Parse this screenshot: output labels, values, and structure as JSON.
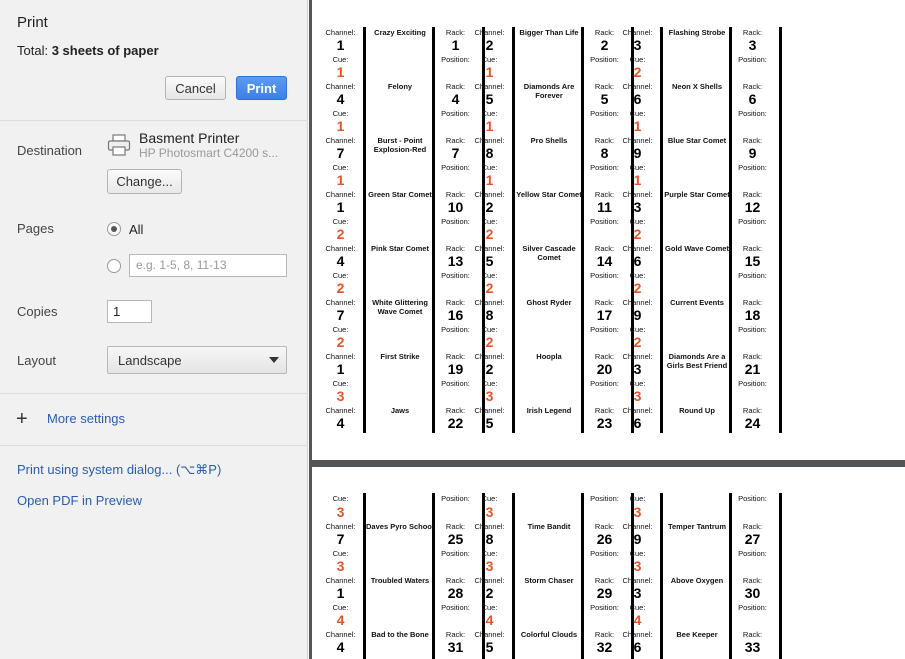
{
  "panel": {
    "title": "Print",
    "total_label": "Total:",
    "total_value": "3 sheets of paper",
    "cancel": "Cancel",
    "print": "Print",
    "destination_label": "Destination",
    "printer_name": "Basment Printer",
    "printer_model": "HP Photosmart C4200 s...",
    "change": "Change...",
    "pages_label": "Pages",
    "pages_all": "All",
    "pages_placeholder": "e.g. 1-5, 8, 11-13",
    "copies_label": "Copies",
    "copies_value": "1",
    "layout_label": "Layout",
    "layout_value": "Landscape",
    "more_settings": "More settings",
    "system_dialog": "Print using system dialog... (⌥⌘P)",
    "open_pdf": "Open PDF in Preview"
  },
  "labels": {
    "channel": "Channel:",
    "cue": "Cue:",
    "rack": "Rack:",
    "position": "Position:"
  },
  "sheet1": {
    "columns": [
      {
        "rows": [
          {
            "channel": "1",
            "cue": "1",
            "name": "Crazy Exciting",
            "rack": "1"
          },
          {
            "channel": "4",
            "cue": "1",
            "name": "Felony",
            "rack": "4"
          },
          {
            "channel": "7",
            "cue": "1",
            "name": "Burst - Point Explosion-Red",
            "rack": "7"
          },
          {
            "channel": "1",
            "cue": "2",
            "name": "Green Star Comet",
            "rack": "10"
          },
          {
            "channel": "4",
            "cue": "2",
            "name": "Pink Star Comet",
            "rack": "13"
          },
          {
            "channel": "7",
            "cue": "2",
            "name": "White Glittering Wave Comet",
            "rack": "16"
          },
          {
            "channel": "1",
            "cue": "3",
            "name": "First Strike",
            "rack": "19"
          },
          {
            "channel": "4",
            "cue": "",
            "name": "Jaws",
            "rack": "22"
          }
        ]
      },
      {
        "rows": [
          {
            "channel": "2",
            "cue": "1",
            "name": "Bigger Than Life",
            "rack": "2"
          },
          {
            "channel": "5",
            "cue": "1",
            "name": "Diamonds Are Forever",
            "rack": "5"
          },
          {
            "channel": "8",
            "cue": "1",
            "name": "Pro Shells",
            "rack": "8"
          },
          {
            "channel": "2",
            "cue": "2",
            "name": "Yellow Star Comet",
            "rack": "11"
          },
          {
            "channel": "5",
            "cue": "2",
            "name": "Silver Cascade Comet",
            "rack": "14"
          },
          {
            "channel": "8",
            "cue": "2",
            "name": "Ghost Ryder",
            "rack": "17"
          },
          {
            "channel": "2",
            "cue": "3",
            "name": "Hoopla",
            "rack": "20"
          },
          {
            "channel": "5",
            "cue": "",
            "name": "Irish Legend",
            "rack": "23"
          }
        ]
      },
      {
        "rows": [
          {
            "channel": "3",
            "cue": "2",
            "name": "Flashing Strobe",
            "rack": "3"
          },
          {
            "channel": "6",
            "cue": "1",
            "name": "Neon X Shells",
            "rack": "6"
          },
          {
            "channel": "9",
            "cue": "1",
            "name": "Blue Star Comet",
            "rack": "9"
          },
          {
            "channel": "3",
            "cue": "2",
            "name": "Purple Star Comet",
            "rack": "12"
          },
          {
            "channel": "6",
            "cue": "2",
            "name": "Gold Wave Comet",
            "rack": "15"
          },
          {
            "channel": "9",
            "cue": "2",
            "name": "Current Events",
            "rack": "18"
          },
          {
            "channel": "3",
            "cue": "3",
            "name": "Diamonds Are a Girls Best Friend",
            "rack": "21"
          },
          {
            "channel": "6",
            "cue": "",
            "name": "Round Up",
            "rack": "24"
          }
        ]
      }
    ]
  },
  "sheet2": {
    "columns": [
      {
        "top_cue": "3",
        "rows": [
          {
            "channel": "7",
            "cue": "3",
            "name": "Daves Pyro School",
            "rack": "25"
          },
          {
            "channel": "1",
            "cue": "4",
            "name": "Troubled Waters",
            "rack": "28"
          },
          {
            "channel": "4",
            "cue": "",
            "name": "Bad to the Bone",
            "rack": "31"
          }
        ]
      },
      {
        "top_cue": "3",
        "rows": [
          {
            "channel": "8",
            "cue": "3",
            "name": "Time Bandit",
            "rack": "26"
          },
          {
            "channel": "2",
            "cue": "4",
            "name": "Storm Chaser",
            "rack": "29"
          },
          {
            "channel": "5",
            "cue": "",
            "name": "Colorful Clouds",
            "rack": "32"
          }
        ]
      },
      {
        "top_cue": "3",
        "rows": [
          {
            "channel": "9",
            "cue": "3",
            "name": "Temper Tantrum",
            "rack": "27"
          },
          {
            "channel": "3",
            "cue": "4",
            "name": "Above Oxygen",
            "rack": "30"
          },
          {
            "channel": "6",
            "cue": "",
            "name": "Bee Keeper",
            "rack": "33"
          }
        ]
      }
    ]
  },
  "colors": {
    "cue_red": "#e8542a",
    "print_blue": "#3d80ea",
    "link_blue": "#2a5db0"
  }
}
